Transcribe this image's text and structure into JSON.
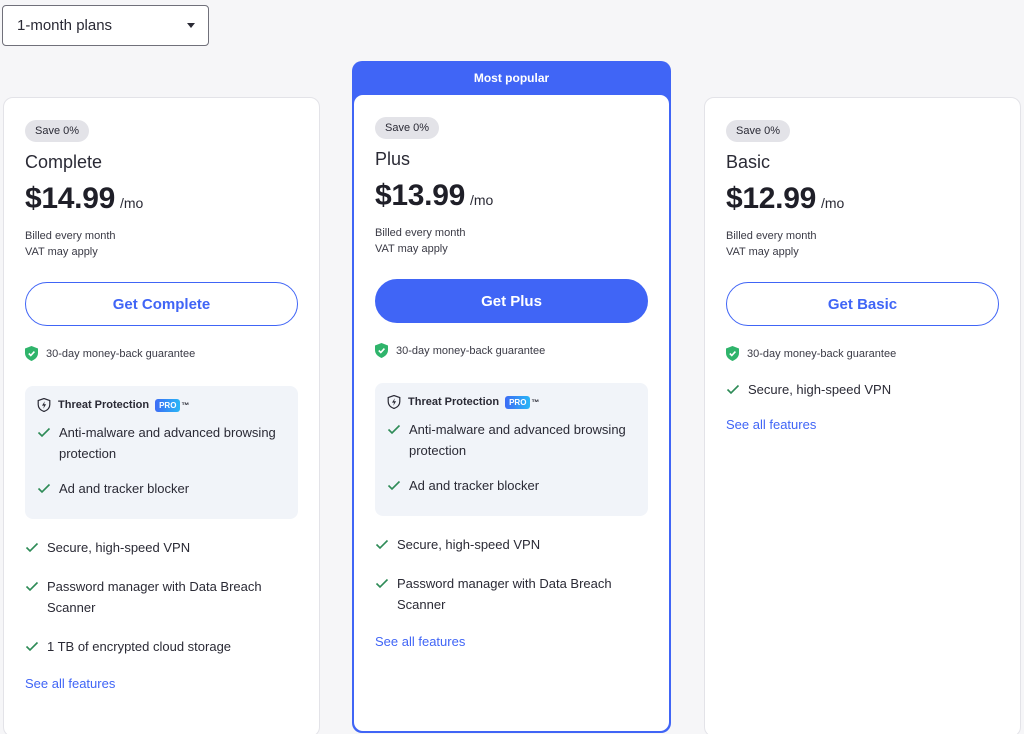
{
  "plan_selector": {
    "value": "1-month plans"
  },
  "popular_label": "Most popular",
  "guarantee_text": "30-day money-back guarantee",
  "threat_protection": {
    "title": "Threat Protection",
    "badge": "PRO",
    "tm": "™"
  },
  "see_all_label": "See all features",
  "plans": {
    "complete": {
      "save": "Save 0%",
      "name": "Complete",
      "price": "$14.99",
      "per": "/mo",
      "billing1": "Billed every month",
      "billing2": "VAT may apply",
      "cta": "Get Complete",
      "tp_features": [
        "Anti-malware and advanced browsing protection",
        "Ad and tracker blocker"
      ],
      "features": [
        "Secure, high-speed VPN",
        "Password manager with Data Breach Scanner",
        "1 TB of encrypted cloud storage"
      ]
    },
    "plus": {
      "save": "Save 0%",
      "name": "Plus",
      "price": "$13.99",
      "per": "/mo",
      "billing1": "Billed every month",
      "billing2": "VAT may apply",
      "cta": "Get Plus",
      "tp_features": [
        "Anti-malware and advanced browsing protection",
        "Ad and tracker blocker"
      ],
      "features": [
        "Secure, high-speed VPN",
        "Password manager with Data Breach Scanner"
      ]
    },
    "basic": {
      "save": "Save 0%",
      "name": "Basic",
      "price": "$12.99",
      "per": "/mo",
      "billing1": "Billed every month",
      "billing2": "VAT may apply",
      "cta": "Get Basic",
      "features": [
        "Secure, high-speed VPN"
      ]
    }
  },
  "colors": {
    "accent": "#4065f6",
    "check": "#2e8b57",
    "shield": "#2fb46b"
  },
  "icons": {
    "dropdown": "chevron-down-icon",
    "guarantee": "shield-check-icon",
    "threat": "shield-bolt-icon",
    "feature": "check-icon"
  }
}
